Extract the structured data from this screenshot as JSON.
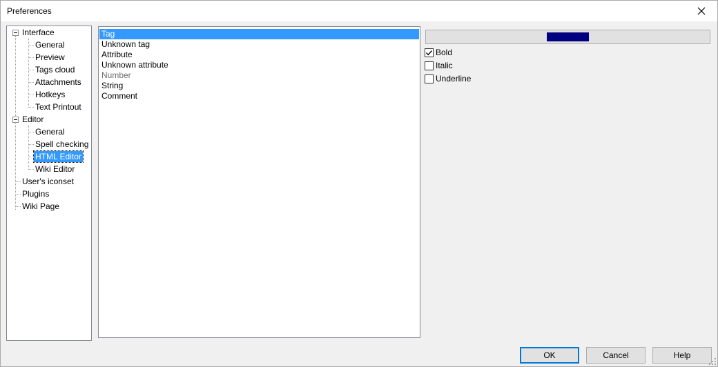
{
  "window": {
    "title": "Preferences"
  },
  "tree": {
    "items": [
      {
        "label": "Interface",
        "level": 0,
        "expanded": true
      },
      {
        "label": "General",
        "level": 1
      },
      {
        "label": "Preview",
        "level": 1
      },
      {
        "label": "Tags cloud",
        "level": 1
      },
      {
        "label": "Attachments",
        "level": 1
      },
      {
        "label": "Hotkeys",
        "level": 1
      },
      {
        "label": "Text Printout",
        "level": 1
      },
      {
        "label": "Editor",
        "level": 0,
        "expanded": true
      },
      {
        "label": "General",
        "level": 1
      },
      {
        "label": "Spell checking",
        "level": 1
      },
      {
        "label": "HTML Editor",
        "level": 1,
        "selected": true
      },
      {
        "label": "Wiki Editor",
        "level": 1
      },
      {
        "label": "User's iconset",
        "level": 0
      },
      {
        "label": "Plugins",
        "level": 0
      },
      {
        "label": "Wiki Page",
        "level": 0
      }
    ]
  },
  "syntax_list": {
    "items": [
      {
        "label": "Tag",
        "selected": true
      },
      {
        "label": "Unknown tag"
      },
      {
        "label": "Attribute"
      },
      {
        "label": "Unknown attribute"
      },
      {
        "label": "Number",
        "gray": true
      },
      {
        "label": "String"
      },
      {
        "label": "Comment"
      }
    ]
  },
  "style": {
    "color": "#000080",
    "bold": {
      "label": "Bold",
      "checked": true
    },
    "italic": {
      "label": "Italic",
      "checked": false
    },
    "underline": {
      "label": "Underline",
      "checked": false
    }
  },
  "buttons": {
    "ok": "OK",
    "cancel": "Cancel",
    "help": "Help"
  },
  "colors": {
    "selection": "#3399ff",
    "swatch": "#000080"
  }
}
